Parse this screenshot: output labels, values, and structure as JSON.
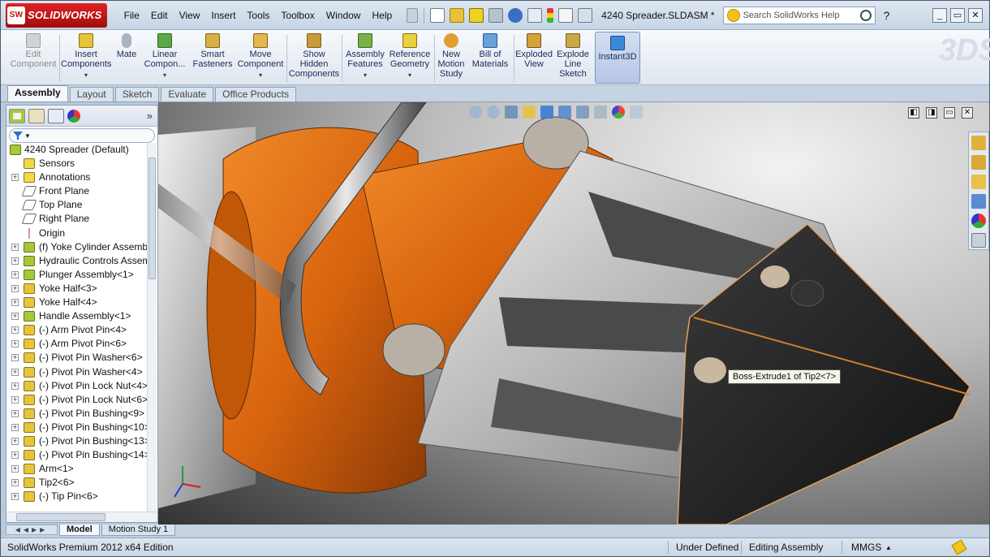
{
  "app": {
    "brand": "SOLIDWORKS",
    "brand_mark": "SW",
    "document_title": "4240 Spreader.SLDASM *"
  },
  "menu": [
    "File",
    "Edit",
    "View",
    "Insert",
    "Tools",
    "Toolbox",
    "Window",
    "Help"
  ],
  "search": {
    "placeholder": "Search SolidWorks Help"
  },
  "help_label": "?",
  "window_buttons": [
    "_",
    "▭",
    "✕"
  ],
  "commands": [
    {
      "label": "Edit Component",
      "disabled": true
    },
    {
      "label": "Insert Components",
      "dropdown": true
    },
    {
      "label": "Mate"
    },
    {
      "label": "Linear Compon...",
      "dropdown": true
    },
    {
      "label": "Smart Fasteners"
    },
    {
      "label": "Move Component",
      "dropdown": true
    },
    {
      "label": "Show Hidden Components"
    },
    {
      "label": "Assembly Features",
      "dropdown": true
    },
    {
      "label": "Reference Geometry",
      "dropdown": true
    },
    {
      "label": "New Motion Study"
    },
    {
      "label": "Bill of Materials"
    },
    {
      "label": "Exploded View"
    },
    {
      "label": "Explode Line Sketch"
    },
    {
      "label": "Instant3D",
      "active": true
    }
  ],
  "tabs": [
    "Assembly",
    "Layout",
    "Sketch",
    "Evaluate",
    "Office Products"
  ],
  "panel_more": "»",
  "tree": {
    "root": "4240 Spreader  (Default)",
    "items": [
      {
        "label": "Sensors",
        "expand": false
      },
      {
        "label": "Annotations",
        "expand": true
      },
      {
        "label": "Front Plane",
        "expand": false
      },
      {
        "label": "Top Plane",
        "expand": false
      },
      {
        "label": "Right Plane",
        "expand": false
      },
      {
        "label": "Origin",
        "expand": false
      },
      {
        "label": "(f) Yoke Cylinder Assembl",
        "expand": true
      },
      {
        "label": "Hydraulic Controls Assem",
        "expand": true
      },
      {
        "label": "Plunger Assembly<1>",
        "expand": true
      },
      {
        "label": "Yoke Half<3>",
        "expand": true
      },
      {
        "label": "Yoke Half<4>",
        "expand": true
      },
      {
        "label": "Handle Assembly<1>",
        "expand": true
      },
      {
        "label": "(-) Arm Pivot Pin<4>",
        "expand": true
      },
      {
        "label": "(-) Arm Pivot Pin<6>",
        "expand": true
      },
      {
        "label": "(-) Pivot Pin Washer<6>",
        "expand": true
      },
      {
        "label": "(-) Pivot Pin Washer<4>",
        "expand": true
      },
      {
        "label": "(-) Pivot Pin Lock Nut<4>",
        "expand": true
      },
      {
        "label": "(-) Pivot Pin Lock Nut<6>",
        "expand": true
      },
      {
        "label": "(-) Pivot Pin Bushing<9>",
        "expand": true
      },
      {
        "label": "(-) Pivot Pin Bushing<10>",
        "expand": true
      },
      {
        "label": "(-) Pivot Pin Bushing<13>",
        "expand": true
      },
      {
        "label": "(-) Pivot Pin Bushing<14>",
        "expand": true
      },
      {
        "label": "Arm<1>",
        "expand": true
      },
      {
        "label": "Tip2<6>",
        "expand": true
      },
      {
        "label": "(-) Tip Pin<6>",
        "expand": true
      }
    ]
  },
  "viewport": {
    "tooltip": "Boss-Extrude1 of Tip2<7>",
    "controls": [
      "◧",
      "◨",
      "▭",
      "✕"
    ]
  },
  "bottom_tabs": [
    "Model",
    "Motion Study 1"
  ],
  "bottom_nav": "◀◀▶▶",
  "status": {
    "edition": "SolidWorks Premium 2012 x64 Edition",
    "definition": "Under Defined",
    "mode": "Editing Assembly",
    "units": "MMGS",
    "units_arrow": "▲"
  },
  "colors": {
    "part_orange": "#d8640e",
    "steel": "#b8b8b8",
    "tip_black": "#1c1c1c",
    "brand_red": "#c01010"
  }
}
